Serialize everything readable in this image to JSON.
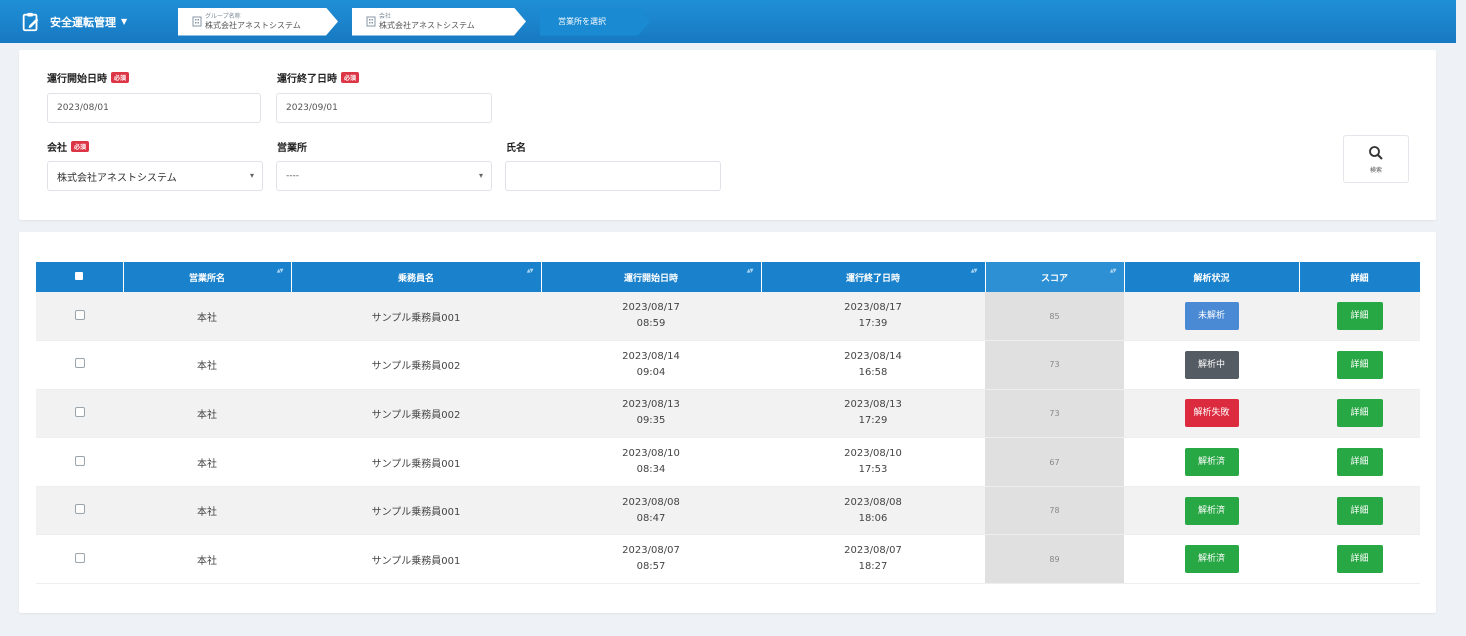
{
  "app": {
    "title": "安全運転管理",
    "icon": "clipboard-edit-icon"
  },
  "breadcrumbs": [
    {
      "small": "グループ名称",
      "main": "株式会社アネストシステム",
      "icon": "building-icon"
    },
    {
      "small": "会社",
      "main": "株式会社アネストシステム",
      "icon": "building-icon"
    },
    {
      "small": "",
      "main": "営業所を選択",
      "icon": ""
    }
  ],
  "filters": {
    "start_label": "運行開始日時",
    "start_value": "2023/08/01",
    "end_label": "運行終了日時",
    "end_value": "2023/09/01",
    "required_badge": "必須",
    "company_label": "会社",
    "company_value": "株式会社アネストシステム",
    "office_label": "営業所",
    "office_value": "----",
    "name_label": "氏名",
    "name_value": "",
    "search_label": "検索",
    "search_icon": "search-icon"
  },
  "table": {
    "headers": {
      "office": "営業所名",
      "driver": "乗務員名",
      "start": "運行開始日時",
      "end": "運行終了日時",
      "score": "スコア",
      "status": "解析状況",
      "detail": "詳細"
    },
    "rows": [
      {
        "office": "本社",
        "driver": "サンプル乗務員001",
        "start_date": "2023/08/17",
        "start_time": "08:59",
        "end_date": "2023/08/17",
        "end_time": "17:39",
        "score": "85",
        "status": "未解析",
        "status_color": "#4a89d4",
        "detail": "詳細"
      },
      {
        "office": "本社",
        "driver": "サンプル乗務員002",
        "start_date": "2023/08/14",
        "start_time": "09:04",
        "end_date": "2023/08/14",
        "end_time": "16:58",
        "score": "73",
        "status": "解析中",
        "status_color": "#545b62",
        "detail": "詳細"
      },
      {
        "office": "本社",
        "driver": "サンプル乗務員002",
        "start_date": "2023/08/13",
        "start_time": "09:35",
        "end_date": "2023/08/13",
        "end_time": "17:29",
        "score": "73",
        "status": "解析失敗",
        "status_color": "#dc2b3f",
        "detail": "詳細"
      },
      {
        "office": "本社",
        "driver": "サンプル乗務員001",
        "start_date": "2023/08/10",
        "start_time": "08:34",
        "end_date": "2023/08/10",
        "end_time": "17:53",
        "score": "67",
        "status": "解析済",
        "status_color": "#28a745",
        "detail": "詳細"
      },
      {
        "office": "本社",
        "driver": "サンプル乗務員001",
        "start_date": "2023/08/08",
        "start_time": "08:47",
        "end_date": "2023/08/08",
        "end_time": "18:06",
        "score": "78",
        "status": "解析済",
        "status_color": "#28a745",
        "detail": "詳細"
      },
      {
        "office": "本社",
        "driver": "サンプル乗務員001",
        "start_date": "2023/08/07",
        "start_time": "08:57",
        "end_date": "2023/08/07",
        "end_time": "18:27",
        "score": "89",
        "status": "解析済",
        "status_color": "#28a745",
        "detail": "詳細"
      }
    ]
  },
  "colors": {
    "topbar": "#1a86cf",
    "header": "#1a82cc",
    "detail_button": "#28a745"
  }
}
